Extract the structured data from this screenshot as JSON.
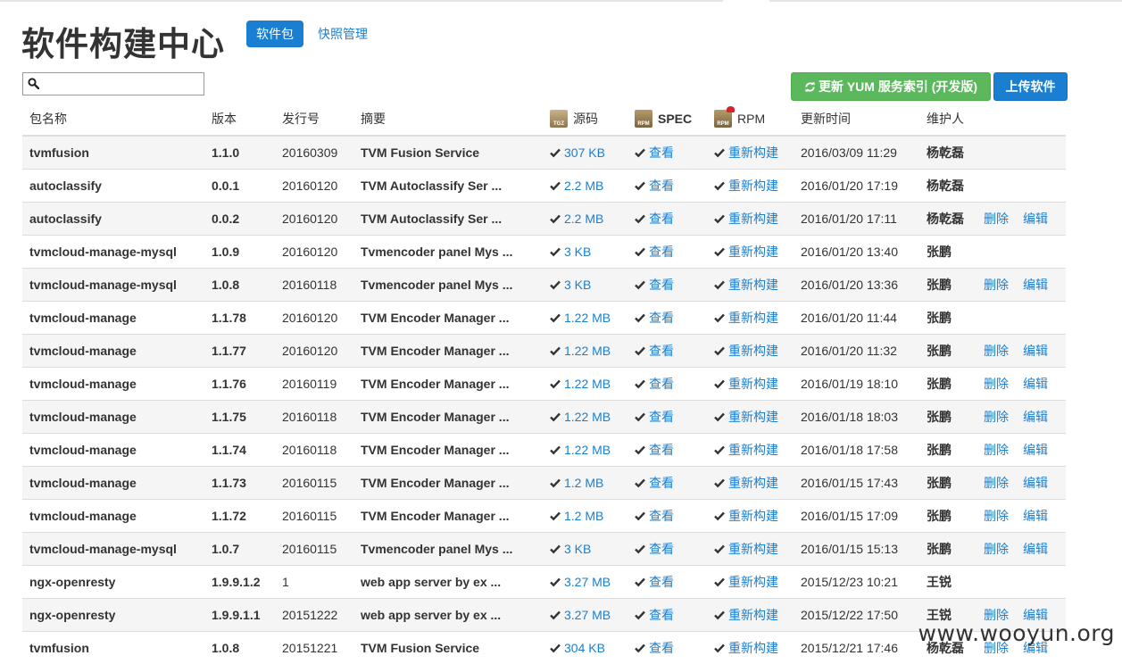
{
  "page": {
    "title": "软件构建中心"
  },
  "nav": {
    "tabs": [
      {
        "label": "软件包",
        "active": true
      },
      {
        "label": "快照管理",
        "active": false
      }
    ]
  },
  "search": {
    "value": "",
    "placeholder": ""
  },
  "toolbar": {
    "refresh_label": "更新 YUM 服务索引 (开发版)",
    "upload_label": "上传软件"
  },
  "table": {
    "headers": {
      "name": "包名称",
      "version": "版本",
      "release": "发行号",
      "summary": "摘要",
      "source": "源码",
      "spec": "SPEC",
      "rpm": "RPM",
      "updated": "更新时间",
      "maintainer": "维护人"
    },
    "view_label": "查看",
    "rebuild_label": "重新构建",
    "delete_label": "删除",
    "edit_label": "编辑",
    "rows": [
      {
        "name": "tvmfusion",
        "version": "1.1.0",
        "release": "20160309",
        "summary": "TVM Fusion Service",
        "size": "307 KB",
        "updated": "2016/03/09 11:29",
        "maintainer": "杨乾磊",
        "actions": false
      },
      {
        "name": "autoclassify",
        "version": "0.0.1",
        "release": "20160120",
        "summary": "TVM Autoclassify Ser ...",
        "size": "2.2 MB",
        "updated": "2016/01/20 17:19",
        "maintainer": "杨乾磊",
        "actions": false
      },
      {
        "name": "autoclassify",
        "version": "0.0.2",
        "release": "20160120",
        "summary": "TVM Autoclassify Ser ...",
        "size": "2.2 MB",
        "updated": "2016/01/20 17:11",
        "maintainer": "杨乾磊",
        "actions": true
      },
      {
        "name": "tvmcloud-manage-mysql",
        "version": "1.0.9",
        "release": "20160120",
        "summary": "Tvmencoder panel Mys ...",
        "size": "3 KB",
        "updated": "2016/01/20 13:40",
        "maintainer": "张鹏",
        "actions": false
      },
      {
        "name": "tvmcloud-manage-mysql",
        "version": "1.0.8",
        "release": "20160118",
        "summary": "Tvmencoder panel Mys ...",
        "size": "3 KB",
        "updated": "2016/01/20 13:36",
        "maintainer": "张鹏",
        "actions": true
      },
      {
        "name": "tvmcloud-manage",
        "version": "1.1.78",
        "release": "20160120",
        "summary": "TVM Encoder Manager ...",
        "size": "1.22 MB",
        "updated": "2016/01/20 11:44",
        "maintainer": "张鹏",
        "actions": false
      },
      {
        "name": "tvmcloud-manage",
        "version": "1.1.77",
        "release": "20160120",
        "summary": "TVM Encoder Manager ...",
        "size": "1.22 MB",
        "updated": "2016/01/20 11:32",
        "maintainer": "张鹏",
        "actions": true
      },
      {
        "name": "tvmcloud-manage",
        "version": "1.1.76",
        "release": "20160119",
        "summary": "TVM Encoder Manager ...",
        "size": "1.22 MB",
        "updated": "2016/01/19 18:10",
        "maintainer": "张鹏",
        "actions": true
      },
      {
        "name": "tvmcloud-manage",
        "version": "1.1.75",
        "release": "20160118",
        "summary": "TVM Encoder Manager ...",
        "size": "1.22 MB",
        "updated": "2016/01/18 18:03",
        "maintainer": "张鹏",
        "actions": true
      },
      {
        "name": "tvmcloud-manage",
        "version": "1.1.74",
        "release": "20160118",
        "summary": "TVM Encoder Manager ...",
        "size": "1.22 MB",
        "updated": "2016/01/18 17:58",
        "maintainer": "张鹏",
        "actions": true
      },
      {
        "name": "tvmcloud-manage",
        "version": "1.1.73",
        "release": "20160115",
        "summary": "TVM Encoder Manager ...",
        "size": "1.2 MB",
        "updated": "2016/01/15 17:43",
        "maintainer": "张鹏",
        "actions": true
      },
      {
        "name": "tvmcloud-manage",
        "version": "1.1.72",
        "release": "20160115",
        "summary": "TVM Encoder Manager ...",
        "size": "1.2 MB",
        "updated": "2016/01/15 17:09",
        "maintainer": "张鹏",
        "actions": true
      },
      {
        "name": "tvmcloud-manage-mysql",
        "version": "1.0.7",
        "release": "20160115",
        "summary": "Tvmencoder panel Mys ...",
        "size": "3 KB",
        "updated": "2016/01/15 15:13",
        "maintainer": "张鹏",
        "actions": true
      },
      {
        "name": "ngx-openresty",
        "version": "1.9.9.1.2",
        "release": "1",
        "summary": "web app server by ex ...",
        "size": "3.27 MB",
        "updated": "2015/12/23 10:21",
        "maintainer": "王锐",
        "actions": false
      },
      {
        "name": "ngx-openresty",
        "version": "1.9.9.1.1",
        "release": "20151222",
        "summary": "web app server by ex ...",
        "size": "3.27 MB",
        "updated": "2015/12/22 17:50",
        "maintainer": "王锐",
        "actions": true
      },
      {
        "name": "tvmfusion",
        "version": "1.0.8",
        "release": "20151221",
        "summary": "TVM Fusion Service",
        "size": "304 KB",
        "updated": "2015/12/21 17:46",
        "maintainer": "杨乾磊",
        "actions": true
      }
    ]
  },
  "watermark": "www.wooyun.org",
  "colors": {
    "link": "#1a7fd0",
    "primary": "#1a7fd0",
    "success": "#5cb85c",
    "stripe": "#f5f5f5"
  }
}
